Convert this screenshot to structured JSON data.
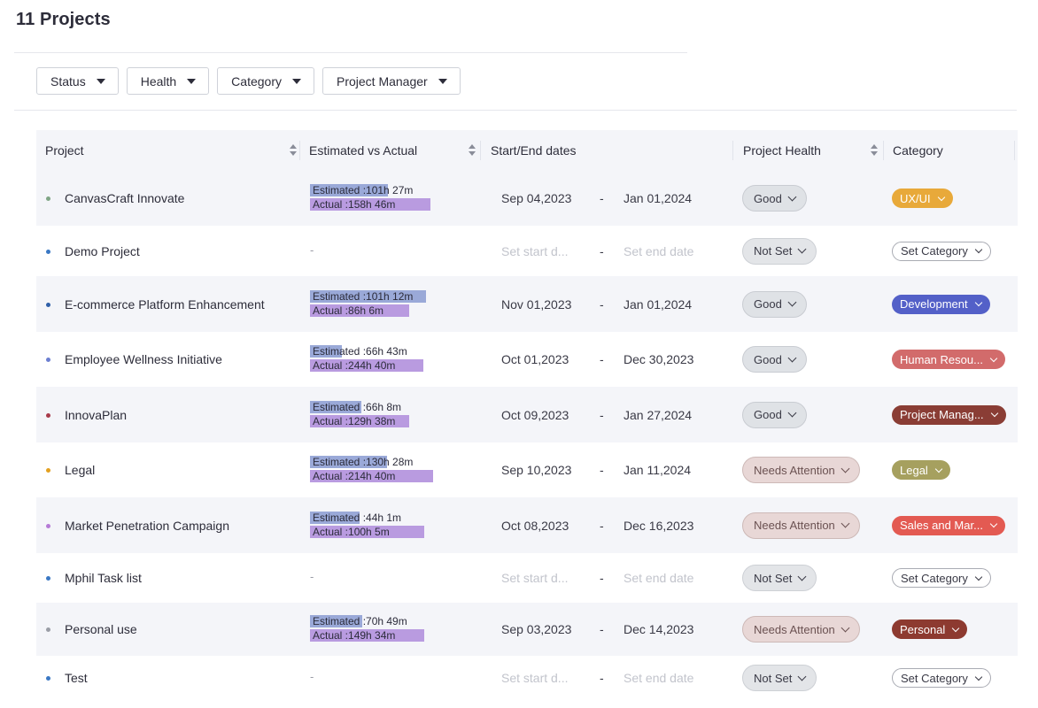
{
  "page": {
    "title": "11 Projects"
  },
  "filters": [
    {
      "label": "Status"
    },
    {
      "label": "Health"
    },
    {
      "label": "Category"
    },
    {
      "label": "Project Manager"
    }
  ],
  "columns": {
    "project": "Project",
    "est_actual": "Estimated vs Actual",
    "dates": "Start/End dates",
    "health": "Project Health",
    "category": "Category"
  },
  "placeholders": {
    "start": "Set start d...",
    "end": "Set end date",
    "category": "Set Category",
    "empty": "-"
  },
  "rows": [
    {
      "name": "CanvasCraft Innovate",
      "dot": "#7fa585",
      "estimated": "Estimated :101h 27m",
      "actual": "Actual :158h 46m",
      "est_frac": 0.52,
      "act_frac": 0.8,
      "start": "Sep 04,2023",
      "end": "Jan 01,2024",
      "health": "Good",
      "health_type": "good",
      "category": "UX/UI",
      "cat_color": "#e8a93a"
    },
    {
      "name": "Demo Project",
      "dot": "#3a78c4",
      "estimated": "",
      "actual": "",
      "start": "",
      "end": "",
      "health": "Not Set",
      "health_type": "notset",
      "category": "",
      "cat_color": ""
    },
    {
      "name": "E-commerce Platform Enhancement",
      "dot": "#2f5fa8",
      "estimated": "Estimated :101h 12m",
      "actual": "Actual :86h 6m",
      "est_frac": 0.77,
      "act_frac": 0.66,
      "start": "Nov 01,2023",
      "end": "Jan 01,2024",
      "health": "Good",
      "health_type": "good",
      "category": "Development",
      "cat_color": "#5360c8"
    },
    {
      "name": "Employee Wellness Initiative",
      "dot": "#6c7fd1",
      "estimated": "Estimated :66h 43m",
      "actual": "Actual :244h 40m",
      "est_frac": 0.21,
      "act_frac": 0.75,
      "start": "Oct 01,2023",
      "end": "Dec 30,2023",
      "health": "Good",
      "health_type": "good",
      "category": "Human Resou...",
      "cat_color": "#d26b6b"
    },
    {
      "name": "InnovaPlan",
      "dot": "#a83a4a",
      "estimated": "Estimated :66h 8m",
      "actual": "Actual :129h 38m",
      "est_frac": 0.34,
      "act_frac": 0.66,
      "start": "Oct 09,2023",
      "end": "Jan 27,2024",
      "health": "Good",
      "health_type": "good",
      "category": "Project Manag...",
      "cat_color": "#8a3d35"
    },
    {
      "name": "Legal",
      "dot": "#e3a020",
      "estimated": "Estimated :130h 28m",
      "actual": "Actual :214h 40m",
      "est_frac": 0.51,
      "act_frac": 0.82,
      "start": "Sep 10,2023",
      "end": "Jan 11,2024",
      "health": "Needs Attention",
      "health_type": "attn",
      "category": "Legal",
      "cat_color": "#a6a05f"
    },
    {
      "name": "Market Penetration Campaign",
      "dot": "#b57ad6",
      "estimated": "Estimated :44h 1m",
      "actual": "Actual :100h 5m",
      "est_frac": 0.33,
      "act_frac": 0.76,
      "start": "Oct 08,2023",
      "end": "Dec 16,2023",
      "health": "Needs Attention",
      "health_type": "attn",
      "category": "Sales and Mar...",
      "cat_color": "#e35a52"
    },
    {
      "name": "Mphil Task list",
      "dot": "#3a78c4",
      "estimated": "",
      "actual": "",
      "start": "",
      "end": "",
      "health": "Not Set",
      "health_type": "notset",
      "category": "",
      "cat_color": ""
    },
    {
      "name": "Personal use",
      "dot": "#9a9da6",
      "estimated": "Estimated :70h 49m",
      "actual": "Actual :149h 34m",
      "est_frac": 0.35,
      "act_frac": 0.76,
      "start": "Sep 03,2023",
      "end": "Dec 14,2023",
      "health": "Needs Attention",
      "health_type": "attn",
      "category": "Personal",
      "cat_color": "#8d3a30"
    },
    {
      "name": "Test",
      "dot": "#3a78c4",
      "estimated": "",
      "actual": "",
      "start": "",
      "end": "",
      "health": "Not Set",
      "health_type": "notset",
      "category": "",
      "cat_color": ""
    }
  ]
}
